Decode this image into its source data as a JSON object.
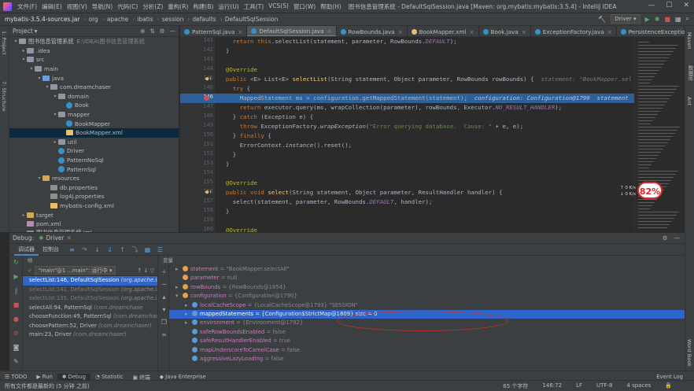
{
  "window": {
    "title": "图书信息管理系统 - DefaultSqlSession.java [Maven: org.mybatis:mybatis:3.5.4] - IntelliJ IDEA",
    "menu": [
      "文件(F)",
      "编辑(E)",
      "视图(V)",
      "导航(N)",
      "代码(C)",
      "分析(Z)",
      "重构(R)",
      "构建(B)",
      "运行(U)",
      "工具(T)",
      "VCS(S)",
      "窗口(W)",
      "帮助(H)"
    ],
    "controls": [
      "—",
      "☐",
      "✕"
    ]
  },
  "breadcrumb": [
    "mybatis-3.5.4-sources.jar",
    "org",
    "apache",
    "ibatis",
    "session",
    "defaults",
    "DefaultSqlSession"
  ],
  "run_config": "Driver",
  "project": {
    "title": "Project",
    "tree": [
      {
        "indent": 0,
        "tw": "▾",
        "icon": "fold",
        "label": "图书信息管理系统",
        "hint": "E:\\IDEA\\图书信息管理系统"
      },
      {
        "indent": 1,
        "tw": "▸",
        "icon": "fold",
        "label": ".idea"
      },
      {
        "indent": 1,
        "tw": "▾",
        "icon": "fold",
        "label": "src"
      },
      {
        "indent": 2,
        "tw": "▾",
        "icon": "fold",
        "label": "main"
      },
      {
        "indent": 3,
        "tw": "▾",
        "icon": "foldb",
        "label": "java"
      },
      {
        "indent": 4,
        "tw": "▾",
        "icon": "fold",
        "label": "com.dreamchaser"
      },
      {
        "indent": 5,
        "tw": "▾",
        "icon": "fold",
        "label": "domain"
      },
      {
        "indent": 6,
        "tw": "",
        "icon": "fcls",
        "label": "Book"
      },
      {
        "indent": 5,
        "tw": "▾",
        "icon": "fold",
        "label": "mapper"
      },
      {
        "indent": 6,
        "tw": "",
        "icon": "fcls",
        "label": "BookMapper"
      },
      {
        "indent": 6,
        "tw": "",
        "icon": "fxml",
        "label": "BookMapper.xml",
        "sel": true
      },
      {
        "indent": 5,
        "tw": "▸",
        "icon": "fold",
        "label": "util"
      },
      {
        "indent": 5,
        "tw": "",
        "icon": "fcls",
        "label": "Driver"
      },
      {
        "indent": 5,
        "tw": "",
        "icon": "fcls",
        "label": "PatternNoSql"
      },
      {
        "indent": 5,
        "tw": "",
        "icon": "fcls",
        "label": "PatternSql"
      },
      {
        "indent": 3,
        "tw": "▾",
        "icon": "foldg",
        "label": "resources"
      },
      {
        "indent": 4,
        "tw": "",
        "icon": "fprop",
        "label": "db.properties"
      },
      {
        "indent": 4,
        "tw": "",
        "icon": "fprop",
        "label": "log4j.properties"
      },
      {
        "indent": 4,
        "tw": "",
        "icon": "fxml",
        "label": "mybatis-config.xml"
      },
      {
        "indent": 1,
        "tw": "▸",
        "icon": "foldg",
        "label": "target"
      },
      {
        "indent": 1,
        "tw": "",
        "icon": "fjar",
        "label": "pom.xml"
      },
      {
        "indent": 1,
        "tw": "",
        "icon": "fprop",
        "label": "图书信息管理系统.iml"
      }
    ]
  },
  "tabs": [
    {
      "label": "PatternSql.java",
      "color": "#3592c4"
    },
    {
      "label": "DefaultSqlSession.java",
      "color": "#3592c4",
      "active": true
    },
    {
      "label": "RowBounds.java",
      "color": "#3592c4"
    },
    {
      "label": "BookMapper.xml",
      "color": "#e8bf6a"
    },
    {
      "label": "Book.java",
      "color": "#3592c4"
    },
    {
      "label": "ExceptionFactory.java",
      "color": "#3592c4"
    },
    {
      "label": "PersistenceException.java",
      "color": "#3592c4"
    }
  ],
  "code": [
    {
      "n": "141",
      "html": "    <span class='k'>return this</span>.selectList(statement, parameter, RowBounds.<span class='it'>DEFAULT</span>);"
    },
    {
      "n": "142",
      "html": "  }"
    },
    {
      "n": "143",
      "html": ""
    },
    {
      "n": "144",
      "html": "  <span class='an'>@Override</span>"
    },
    {
      "n": "145",
      "html": "  <span class='k'>public</span> &lt;E&gt; List&lt;E&gt; <span class='f'>selectList</span>(String statement, Object parameter, RowBounds rowBounds) {  <span class='inl'>statement: \"BookMapper.sel</span>"
    },
    {
      "n": "146",
      "html": "    <span class='k'>try</span> {"
    },
    {
      "n": "146",
      "hl": true,
      "html": "      MappedStatement ms = configuration.getMappedStatement(statement);  <span class='inl' style='color:#b8c8e0'>configuration: Configuration@1790  statement</span>"
    },
    {
      "n": "147",
      "html": "      <span class='k'>return</span> executor.query(ms, wrapCollection(parameter), rowBounds, Executor.<span class='it'>NO_RESULT_HANDLER</span>);"
    },
    {
      "n": "148",
      "html": "    } <span class='k'>catch</span> (Exception e) {"
    },
    {
      "n": "149",
      "html": "      <span class='k'>throw</span> ExceptionFactory.<span class='it' style='color:#a9b7c6'>wrapException</span>(<span class='s'>\"Error querying database.  Cause: \"</span> + e, e);"
    },
    {
      "n": "150",
      "html": "    } <span class='k'>finally</span> {"
    },
    {
      "n": "151",
      "html": "      ErrorContext.<span class='it' style='color:#a9b7c6'>instance</span>().reset();"
    },
    {
      "n": "152",
      "html": "    }"
    },
    {
      "n": "153",
      "html": "  }"
    },
    {
      "n": "154",
      "html": ""
    },
    {
      "n": "155",
      "html": "  <span class='an'>@Override</span>"
    },
    {
      "n": "156",
      "html": "  <span class='k'>public void</span> <span class='f'>select</span>(String statement, Object parameter, ResultHandler handler) {"
    },
    {
      "n": "157",
      "html": "    select(statement, parameter, RowBounds.<span class='it'>DEFAULT</span>, handler);"
    },
    {
      "n": "158",
      "html": "  }"
    },
    {
      "n": "159",
      "html": ""
    },
    {
      "n": "160",
      "html": "  <span class='an'>@Override</span>"
    }
  ],
  "overlay": {
    "percent": "82%",
    "up": "0 K/s",
    "down": "0 K/s"
  },
  "debug": {
    "title": "Debug:",
    "config": "Driver",
    "tabs": [
      "调试器",
      "控制台"
    ],
    "frames_label": "帧",
    "vars_label": "变量",
    "thread": "\"main\"@1 ...main\": 运行中",
    "frames": [
      {
        "text": "selectList:146, DefaultSqlSession",
        "cls": "(org.apache.il",
        "sel": true
      },
      {
        "text": "selectList:141, DefaultSqlSession",
        "cls": "(org.apache.il",
        "grey": true
      },
      {
        "text": "selectList:135, DefaultSqlSession",
        "cls": "(org.apache.il",
        "grey": true
      },
      {
        "text": "selectAll:94, PatternSql",
        "cls": "(com.dreamchase"
      },
      {
        "text": "chooseFunction:49, PatternSql",
        "cls": "(com.dreamchase"
      },
      {
        "text": "choosePattern:52, Driver",
        "cls": "(com.dreamchaser)"
      },
      {
        "text": "main:23, Driver",
        "cls": "(com.dreamchaser)"
      }
    ],
    "variables": [
      {
        "ind": 0,
        "tw": "▸",
        "dot": "p",
        "name": "statement",
        "val": "= \"BookMapper.selectAll\""
      },
      {
        "ind": 0,
        "tw": "",
        "dot": "p",
        "name": "parameter",
        "val": "= null"
      },
      {
        "ind": 0,
        "tw": "▸",
        "dot": "p",
        "name": "rowBounds",
        "val": "= {RowBounds@1854}"
      },
      {
        "ind": 0,
        "tw": "▾",
        "dot": "oo",
        "name": "configuration",
        "val": "= {Configuration@1790}"
      },
      {
        "ind": 1,
        "tw": "▸",
        "dot": "f",
        "name": "localCacheScope",
        "val": "= {LocalCacheScope@1793} \"SESSION\""
      },
      {
        "ind": 1,
        "tw": "▸",
        "dot": "f",
        "name": "mappedStatements",
        "val": "= {Configuration$StrictMap@1809}  size = 0",
        "sel": true
      },
      {
        "ind": 1,
        "tw": "▸",
        "dot": "f",
        "name": "environment",
        "val": "= {Environment@1792}"
      },
      {
        "ind": 1,
        "tw": "",
        "dot": "f",
        "name": "safeRowBoundsEnabled",
        "val": "= false"
      },
      {
        "ind": 1,
        "tw": "",
        "dot": "f",
        "name": "safeResultHandlerEnabled",
        "val": "= true"
      },
      {
        "ind": 1,
        "tw": "",
        "dot": "f",
        "name": "mapUnderscoreToCamelCase",
        "val": "= false"
      },
      {
        "ind": 1,
        "tw": "",
        "dot": "f",
        "name": "aggressiveLazyLoading",
        "val": "= false"
      }
    ]
  },
  "bottom_tabs": [
    "☰ TODO",
    "▶ Run",
    "✱ Debug",
    "◔ Statistic",
    "▣ 终端",
    "◆ Java Enterprise"
  ],
  "event_log": "Event Log",
  "status": {
    "message": "所有文件都是最新的 (5 分钟 之前)",
    "chars": "65 个字符",
    "pos": "146:72",
    "le": "LF",
    "enc": "UTF-8",
    "indent": "4 spaces"
  },
  "watermark": "武\n\n纪"
}
